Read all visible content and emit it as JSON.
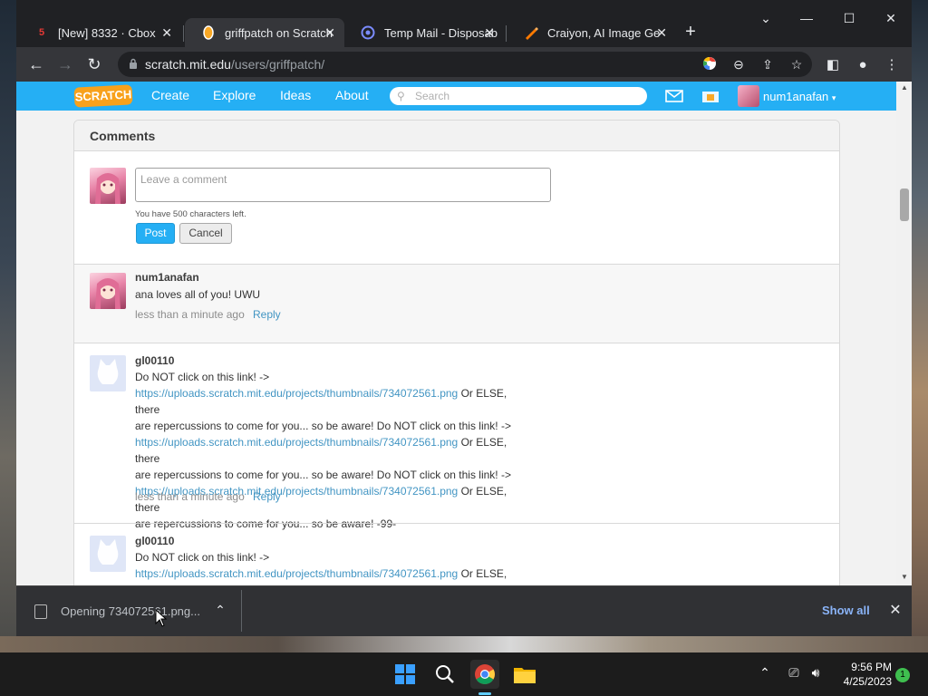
{
  "browser": {
    "tabs": [
      {
        "title": "[New] 8332 · Cbox",
        "favicon": "cbox-icon",
        "active": false
      },
      {
        "title": "griffpatch on Scratch",
        "favicon": "scratch-icon",
        "active": true
      },
      {
        "title": "Temp Mail - Disposab",
        "favicon": "tempmail-icon",
        "active": false
      },
      {
        "title": "Craiyon, AI Image Ge",
        "favicon": "craiyon-icon",
        "active": false
      }
    ],
    "url_host": "scratch.mit.edu",
    "url_path": "/users/griffpatch/"
  },
  "scratch": {
    "nav": {
      "logo": "SCRATCH",
      "create": "Create",
      "explore": "Explore",
      "ideas": "Ideas",
      "about": "About",
      "search_placeholder": "Search",
      "username": "num1anafan",
      "caret": "▾"
    },
    "comments": {
      "title": "Comments",
      "placeholder": "Leave a comment",
      "chars_left": "You have 500 characters left.",
      "post": "Post",
      "cancel": "Cancel",
      "items": [
        {
          "user": "num1anafan",
          "text": "ana loves all of you! UWU",
          "time": "less than a minute ago",
          "reply": "Reply"
        },
        {
          "user": "gl00110",
          "lines": [
            {
              "pre": "Do NOT click on this link! ->",
              "link": "",
              "post": ""
            },
            {
              "pre": "",
              "link": "https://uploads.scratch.mit.edu/projects/thumbnails/734072561.png",
              "post": " Or ELSE, there"
            },
            {
              "pre": "are repercussions to come for you... so be aware! Do NOT click on this link! ->",
              "link": "",
              "post": ""
            },
            {
              "pre": "",
              "link": "https://uploads.scratch.mit.edu/projects/thumbnails/734072561.png",
              "post": " Or ELSE, there"
            },
            {
              "pre": "are repercussions to come for you... so be aware! Do NOT click on this link! ->",
              "link": "",
              "post": ""
            },
            {
              "pre": "",
              "link": "https://uploads.scratch.mit.edu/projects/thumbnails/734072561.png",
              "post": " Or ELSE, there"
            },
            {
              "pre": "are repercussions to come for you... so be aware! -99-",
              "link": "",
              "post": ""
            }
          ],
          "time": "less than a minute ago",
          "reply": "Reply"
        },
        {
          "user": "gl00110",
          "lines": [
            {
              "pre": "Do NOT click on this link! ->",
              "link": "",
              "post": ""
            },
            {
              "pre": "",
              "link": "https://uploads.scratch.mit.edu/projects/thumbnails/734072561.png",
              "post": " Or ELSE, there"
            }
          ]
        }
      ]
    }
  },
  "downloads": {
    "item": "Opening 734072561.png...",
    "show_all": "Show all"
  },
  "taskbar": {
    "time": "9:56 PM",
    "date": "4/25/2023",
    "notifications": "1"
  },
  "colors": {
    "scratch_blue": "#25aff4",
    "link": "#4295c3",
    "chrome_dark": "#202124"
  }
}
